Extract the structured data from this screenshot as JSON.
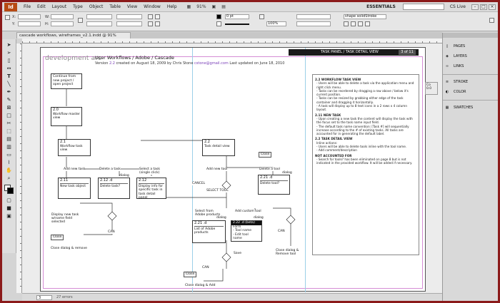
{
  "menubar": {
    "logo": "Id",
    "items": [
      "File",
      "Edit",
      "Layout",
      "Type",
      "Object",
      "Table",
      "View",
      "Window",
      "Help"
    ],
    "zoom": "91%",
    "workspace": "ESSENTIALS",
    "cslive": "CS Live"
  },
  "controlbar": {
    "stroke_weight": "0 pt",
    "opacity": "100%",
    "style": "shape solidStroke",
    "scale": "100%"
  },
  "document": {
    "tab_title": "cascade workflows, wireframes_v2.1.indd @ 91%"
  },
  "page": {
    "header_title": "TASK PANEL / TASK DETAIL VIEW",
    "page_indicator": "3 of 11",
    "logo": "development arc",
    "title": "User Workflows / Adobe / Cascade",
    "meta_prefix": "Version",
    "version": "2.2",
    "meta_created": "created on",
    "created_date": "August 18, 2009",
    "meta_by": "by",
    "author": "Chris Stone",
    "author_email": "cstone@gmail.com",
    "meta_updated": "Last updated on",
    "updated_date": "June 18, 2010"
  },
  "flow": {
    "b_continue": "Continue from new project / open project",
    "b_master_num": "2.0",
    "b_master": "Workflow master view",
    "b_wf_task_num": "2.1",
    "b_wf_task": "Workflow task view",
    "b_new_task_num": "2.11",
    "b_new_task": "New task object",
    "b_delete_task_num": "2.12 .d",
    "b_delete_task": "Delete task?",
    "b_info_num": "2.12",
    "b_info": "Display info for specific task in task detail panel",
    "b_task_detail_num": "2.2",
    "b_task_detail": "Task detail view",
    "b_delete_tool_num": "2.21 .d",
    "b_delete_tool": "Delete tool?",
    "b_adobe_num": "2.21 .d",
    "b_adobe": "List of Adobe products",
    "l_add_new_task": "Add new task",
    "l_delete_a_task": "Delete a task",
    "l_select_task": "Select a task (single click)",
    "l_add_new_tool": "Add new tool",
    "l_delete_a_tool": "Delete a tool",
    "l_cancel": "CANCEL",
    "l_select_tool": "SELECT TOOL",
    "l_select_from": "Select from Adobe products",
    "l_add_custom": "Add custom tool",
    "l_display_new_task": "Display new task w/name field selected",
    "l_close1": "Close",
    "l_can1": "CAN",
    "l_close_dialog_remove": "Close dialog & remove",
    "l_close_top": "Close",
    "l_close_dialog_remove_tool": "Close dialog & Remove tool",
    "l_can_right": "CAN",
    "l_save": "Save",
    "l_can_bottom": "CAN",
    "l_close_bottom": "Close",
    "l_close_add": "Close dialog & Add",
    "l_dialog": "dialog",
    "sel_head": "2.22 .d (beta)",
    "sel_rows": [
      "Form",
      "- Tool name",
      "- Edit tool",
      "name"
    ]
  },
  "notes": {
    "h1": "2.2 WORKFLOW TASK VIEW",
    "p1": [
      "- Users will be able to delete a task via the application menu and right click menu.",
      "- Tasks can be reordered by dragging a row above / below it's current position.",
      "- Tasks can be resized by grabbing either edge of the task container and dragging it horizontally.",
      "- A task will display up to 8 text icons in a 2 rows x 4 column layout."
    ],
    "h2": "2.11 NEW TASK",
    "p2": [
      "- Upon creating a new task the content will display the task with the focus set to the task name input field.",
      "- The default task name convention: [Task #] will sequentially increase according to the # of existing tasks. All tasks are accounted for in generating the default label."
    ],
    "h3": "2.2 TASK DETAIL VIEW",
    "p3": [
      "Inline actions:",
      "- Users will be able to delete tools inline with the tool name.",
      "- Add comment/description"
    ],
    "h4": "NOT ACCOUNTED FOR",
    "p4": [
      "- Search for tools? has been eliminated on page 8 but is not indicated in the provided workflow. It will be added if necessary."
    ]
  },
  "statusbar": {
    "page": "3",
    "errors": "27 errors"
  },
  "panels": {
    "items": [
      "PAGES",
      "LAYERS",
      "LINKS",
      "STROKE",
      "COLOR",
      "SWATCHES"
    ],
    "dock_label": "Co 0.0"
  }
}
